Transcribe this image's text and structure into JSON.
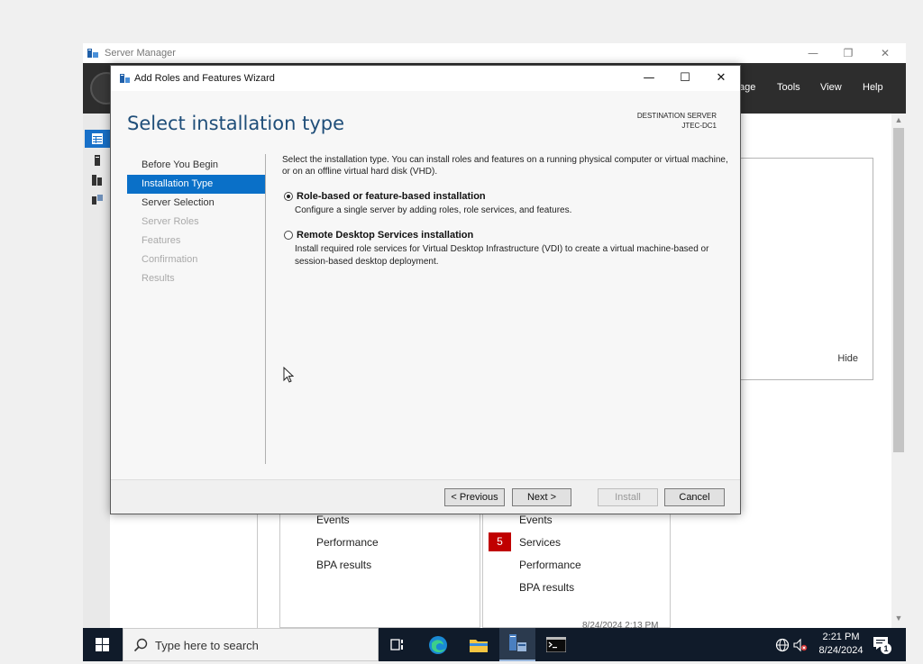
{
  "server_manager": {
    "title": "Server Manager",
    "controls": {
      "minimize": "—",
      "restore": "❐",
      "close": "✕"
    },
    "menu": [
      "age",
      "Tools",
      "View",
      "Help"
    ],
    "panel": {
      "hide_label": "Hide"
    },
    "tiles": [
      {
        "items": [
          "Events",
          "Performance",
          "BPA results"
        ]
      },
      {
        "items": [
          "Events",
          "Services",
          "Performance",
          "BPA results"
        ],
        "badge": "5",
        "timestamp": "8/24/2024 2:13 PM"
      }
    ],
    "colors": {
      "header": "#2d2d2d",
      "badge": "#c00000"
    }
  },
  "wizard": {
    "title": "Add Roles and Features Wizard",
    "controls": {
      "minimize": "—",
      "maximize": "☐",
      "close": "✕"
    },
    "heading": "Select installation type",
    "destination_label": "DESTINATION SERVER",
    "destination_server": "JTEC-DC1",
    "nav": [
      {
        "label": "Before You Begin",
        "state": "normal"
      },
      {
        "label": "Installation Type",
        "state": "active"
      },
      {
        "label": "Server Selection",
        "state": "normal"
      },
      {
        "label": "Server Roles",
        "state": "disabled"
      },
      {
        "label": "Features",
        "state": "disabled"
      },
      {
        "label": "Confirmation",
        "state": "disabled"
      },
      {
        "label": "Results",
        "state": "disabled"
      }
    ],
    "intro": "Select the installation type. You can install roles and features on a running physical computer or virtual machine, or on an offline virtual hard disk (VHD).",
    "options": [
      {
        "title": "Role-based or feature-based installation",
        "description": "Configure a single server by adding roles, role services, and features.",
        "checked": true
      },
      {
        "title": "Remote Desktop Services installation",
        "description": "Install required role services for Virtual Desktop Infrastructure (VDI) to create a virtual machine-based or session-based desktop deployment.",
        "checked": false
      }
    ],
    "buttons": {
      "previous": "< Previous",
      "next": "Next >",
      "install": "Install",
      "cancel": "Cancel"
    },
    "colors": {
      "heading": "#1f4e79",
      "active_nav": "#0a70c8"
    }
  },
  "taskbar": {
    "search_placeholder": "Type here to search",
    "time": "2:21 PM",
    "date": "8/24/2024",
    "notification_count": "1",
    "apps": [
      "task-view-icon",
      "edge-icon",
      "file-explorer-icon",
      "server-manager-icon",
      "terminal-icon"
    ]
  }
}
